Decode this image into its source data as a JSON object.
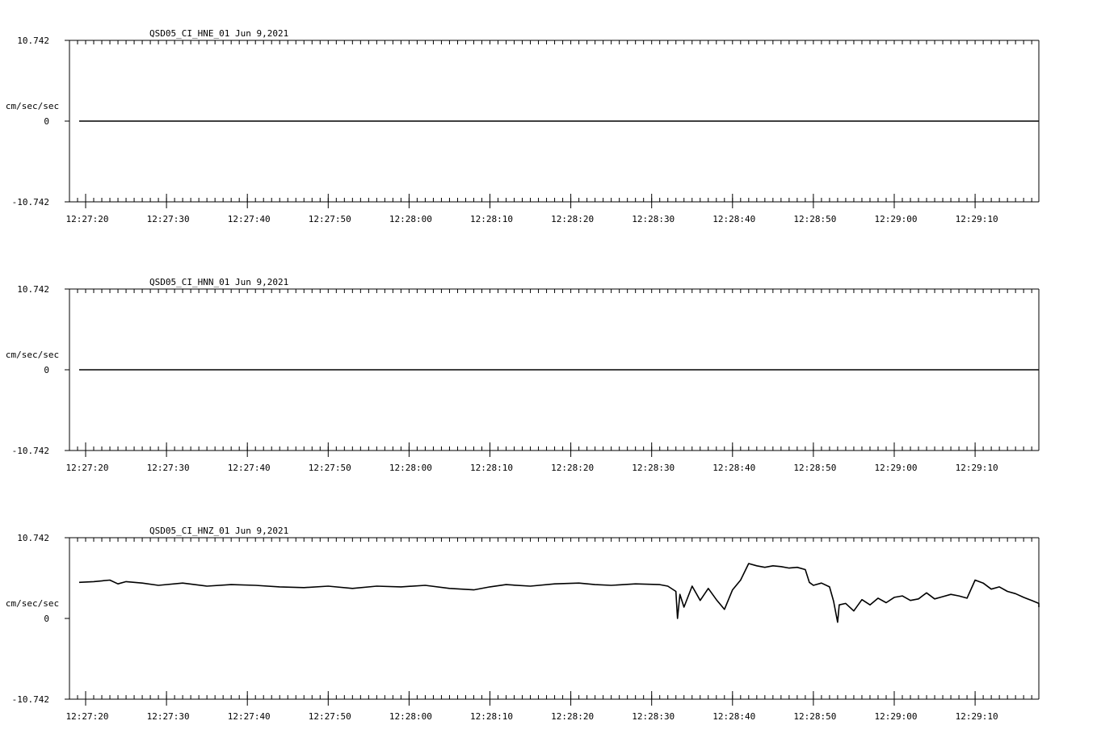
{
  "chart_data": [
    {
      "type": "line",
      "title": "QSD05_CI_HNE_01  Jun 9,2021",
      "ylabel": "cm/sec/sec",
      "ytick_labels": [
        "10.742",
        "0",
        "-10.742"
      ],
      "ylim": [
        -10.742,
        10.742
      ],
      "x_tick_labels": [
        "12:27:20",
        "12:27:30",
        "12:27:40",
        "12:27:50",
        "12:28:00",
        "12:28:10",
        "12:28:20",
        "12:28:30",
        "12:28:40",
        "12:28:50",
        "12:29:00",
        "12:29:10"
      ],
      "x_start": "12:27:18",
      "x_end": "12:29:18",
      "series": [
        {
          "values": [
            [
              -1.2,
              0
            ],
            [
              119,
              0
            ]
          ]
        }
      ]
    },
    {
      "type": "line",
      "title": "QSD05_CI_HNN_01  Jun 9,2021",
      "ylabel": "cm/sec/sec",
      "ytick_labels": [
        "10.742",
        "0",
        "-10.742"
      ],
      "ylim": [
        -10.742,
        10.742
      ],
      "x_tick_labels": [
        "12:27:20",
        "12:27:30",
        "12:27:40",
        "12:27:50",
        "12:28:00",
        "12:28:10",
        "12:28:20",
        "12:28:30",
        "12:28:40",
        "12:28:50",
        "12:29:00",
        "12:29:10"
      ],
      "x_start": "12:27:18",
      "x_end": "12:29:18",
      "series": [
        {
          "values": [
            [
              -1.2,
              0
            ],
            [
              119,
              0
            ]
          ]
        }
      ]
    },
    {
      "type": "line",
      "title": "QSD05_CI_HNZ_01  Jun 9,2021",
      "ylabel": "cm/sec/sec",
      "ytick_labels": [
        "10.742",
        "0",
        "-10.742"
      ],
      "ylim": [
        -10.742,
        10.742
      ],
      "x_tick_labels": [
        "12:27:20",
        "12:27:30",
        "12:27:40",
        "12:27:50",
        "12:28:00",
        "12:28:10",
        "12:28:20",
        "12:28:30",
        "12:28:40",
        "12:28:50",
        "12:29:00",
        "12:29:10"
      ],
      "x_start": "12:27:18",
      "x_end": "12:29:18",
      "series": [
        {
          "values": [
            [
              -1.2,
              4.8
            ],
            [
              1,
              4.9
            ],
            [
              3,
              5.1
            ],
            [
              4,
              4.6
            ],
            [
              5,
              4.9
            ],
            [
              7,
              4.7
            ],
            [
              9,
              4.4
            ],
            [
              12,
              4.7
            ],
            [
              15,
              4.3
            ],
            [
              18,
              4.5
            ],
            [
              21,
              4.4
            ],
            [
              24,
              4.2
            ],
            [
              27,
              4.1
            ],
            [
              30,
              4.3
            ],
            [
              33,
              4.0
            ],
            [
              36,
              4.3
            ],
            [
              39,
              4.2
            ],
            [
              42,
              4.4
            ],
            [
              45,
              4.0
            ],
            [
              48,
              3.8
            ],
            [
              50,
              4.2
            ],
            [
              52,
              4.5
            ],
            [
              55,
              4.3
            ],
            [
              58,
              4.6
            ],
            [
              61,
              4.7
            ],
            [
              63,
              4.5
            ],
            [
              65,
              4.4
            ],
            [
              68,
              4.6
            ],
            [
              71,
              4.5
            ],
            [
              72,
              4.3
            ],
            [
              73,
              3.6
            ],
            [
              73.2,
              0
            ],
            [
              73.5,
              3.2
            ],
            [
              74,
              1.5
            ],
            [
              75,
              4.3
            ],
            [
              76,
              2.4
            ],
            [
              77,
              4.0
            ],
            [
              78,
              2.5
            ],
            [
              79,
              1.2
            ],
            [
              80,
              3.8
            ],
            [
              81,
              5.1
            ],
            [
              82,
              7.3
            ],
            [
              83,
              7.0
            ],
            [
              84,
              6.8
            ],
            [
              85,
              7.0
            ],
            [
              86,
              6.9
            ],
            [
              87,
              6.7
            ],
            [
              88,
              6.8
            ],
            [
              89,
              6.5
            ],
            [
              89.5,
              4.8
            ],
            [
              90,
              4.4
            ],
            [
              91,
              4.7
            ],
            [
              92,
              4.2
            ],
            [
              92.5,
              2.3
            ],
            [
              93,
              -0.5
            ],
            [
              93.2,
              1.8
            ],
            [
              94,
              2.0
            ],
            [
              95,
              1.0
            ],
            [
              96,
              2.5
            ],
            [
              97,
              1.8
            ],
            [
              98,
              2.7
            ],
            [
              99,
              2.1
            ],
            [
              100,
              2.8
            ],
            [
              101,
              3.0
            ],
            [
              102,
              2.4
            ],
            [
              103,
              2.6
            ],
            [
              104,
              3.4
            ],
            [
              105,
              2.6
            ],
            [
              106,
              2.9
            ],
            [
              107,
              3.2
            ],
            [
              108,
              3.0
            ],
            [
              109,
              2.7
            ],
            [
              110,
              5.1
            ],
            [
              111,
              4.7
            ],
            [
              112,
              3.9
            ],
            [
              113,
              4.2
            ],
            [
              114,
              3.6
            ],
            [
              115,
              3.3
            ],
            [
              116,
              2.8
            ],
            [
              117,
              2.4
            ],
            [
              118,
              2.0
            ],
            [
              119,
              1.5
            ]
          ]
        }
      ]
    }
  ]
}
